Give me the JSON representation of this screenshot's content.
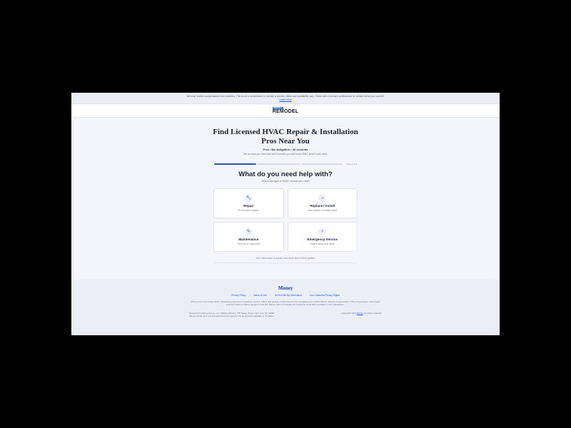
{
  "banner": {
    "text": "We may receive compensation from partners. This is not a commitment to provide a service; offers and availability vary. Check with a licensed professional for details before you commit.",
    "link": "Learn more"
  },
  "header": {
    "logo_top": "MONEY",
    "logo_main": "REMODEL"
  },
  "hero": {
    "title": "Find Licensed HVAC Repair & Installation Pros Near You",
    "tagline": "Free • No obligation • 30 seconds",
    "description": "Tell us what you need and we'll connect you with local HVAC pros in your area."
  },
  "progress": {
    "step_label": "Step 1 of 4",
    "value": 0.25
  },
  "question": {
    "title": "What do you need help with?",
    "subtitle": "Select the type of HVAC service you need"
  },
  "options": [
    {
      "icon": "wrench-icon",
      "glyph": "🔧",
      "title": "Repair",
      "subtitle": "Fix a broken system"
    },
    {
      "icon": "home-icon",
      "glyph": "⌂",
      "title": "Replace / Install",
      "subtitle": "New system or replacement"
    },
    {
      "icon": "pencil-icon",
      "glyph": "✎",
      "title": "Maintenance",
      "subtitle": "Tune-up or inspection"
    },
    {
      "icon": "lightning-icon",
      "glyph": "⚡",
      "title": "Emergency Service",
      "subtitle": "Urgent same-day repair"
    }
  ],
  "privacy_note": "Your information is secure and never sold to third parties.",
  "footer": {
    "brand": "Money",
    "links": [
      "Privacy Policy",
      "Terms of Use",
      "Do Not Sell My Information",
      "Your California Privacy Rights"
    ],
    "disclaimer": "Money.com is an independent, advertising-supported comparison service. Offers that appear on this site are from companies from which Money receives compensation. This compensation may impact how and where products appear on this site. Money does not include all companies or all offers available in the marketplace.",
    "address_line1": "Operated by Money Group, LLC. Mailing address: 250 Vesey Street, New York, NY 10281.",
    "address_line2": "Money Group, LLC is a licensed insurance agency. Not all products available in all states.",
    "copyright_prefix": "Copyright 2024 ",
    "copyright_link": "Money",
    "copyright_suffix": ". All rights reserved."
  },
  "colors": {
    "accent": "#2f56a8",
    "link": "#2456d6",
    "brand": "#1a3fa0"
  }
}
